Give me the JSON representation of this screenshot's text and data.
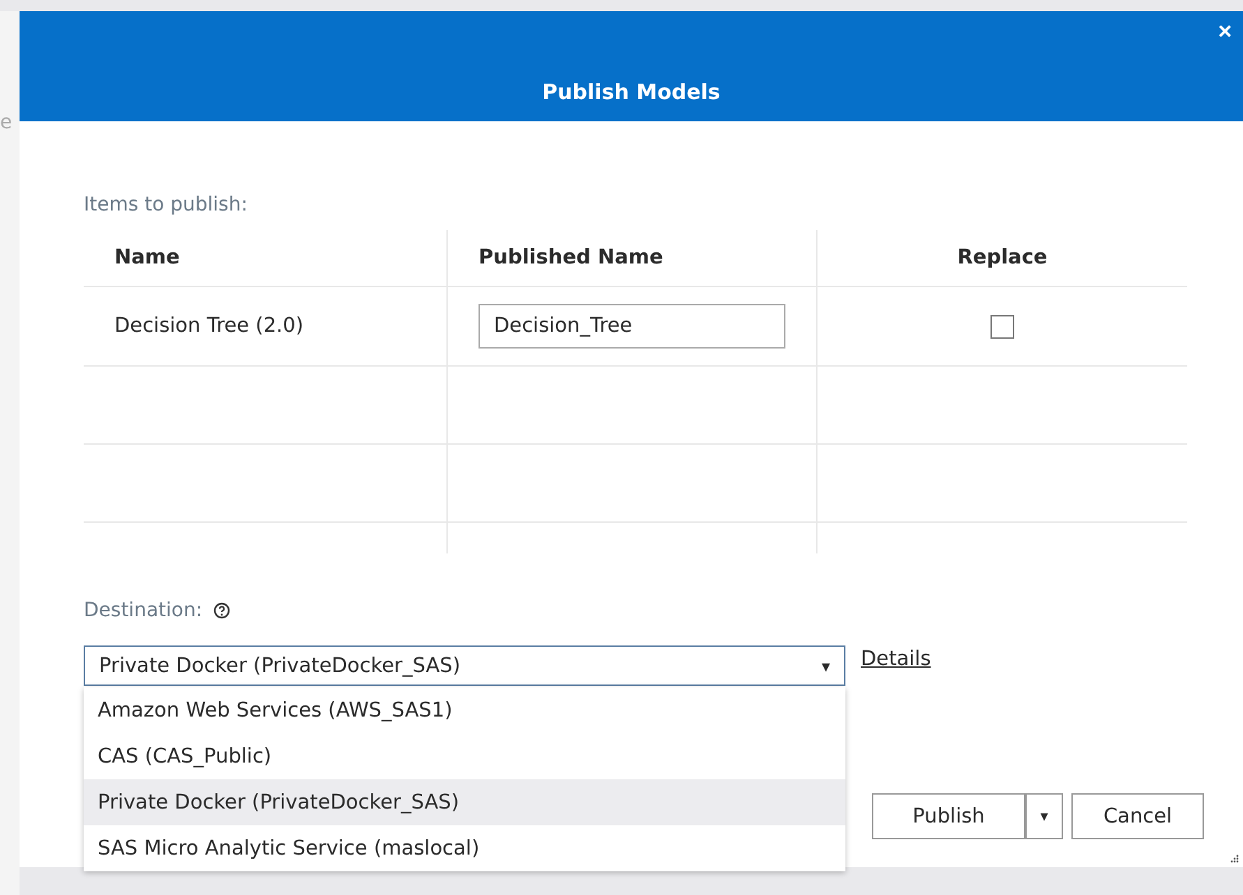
{
  "background_text": "e",
  "dialog": {
    "title": "Publish Models",
    "close": "×"
  },
  "items_label": "Items to publish:",
  "table": {
    "columns": [
      "Name",
      "Published Name",
      "Replace"
    ],
    "rows": [
      {
        "name": "Decision Tree (2.0)",
        "published_name": "Decision_Tree",
        "replace": false
      }
    ]
  },
  "destination": {
    "label": "Destination:",
    "select_value": "Private Docker (PrivateDocker_SAS)",
    "caret": "▾",
    "details_link": "Details",
    "options": [
      {
        "label": "Amazon Web Services (AWS_SAS1)",
        "selected": false
      },
      {
        "label": "CAS (CAS_Public)",
        "selected": false
      },
      {
        "label": "Private Docker (PrivateDocker_SAS)",
        "selected": true
      },
      {
        "label": "SAS Micro Analytic Service (maslocal)",
        "selected": false
      }
    ]
  },
  "buttons": {
    "publish": "Publish",
    "publish_menu": "▾",
    "cancel": "Cancel"
  }
}
